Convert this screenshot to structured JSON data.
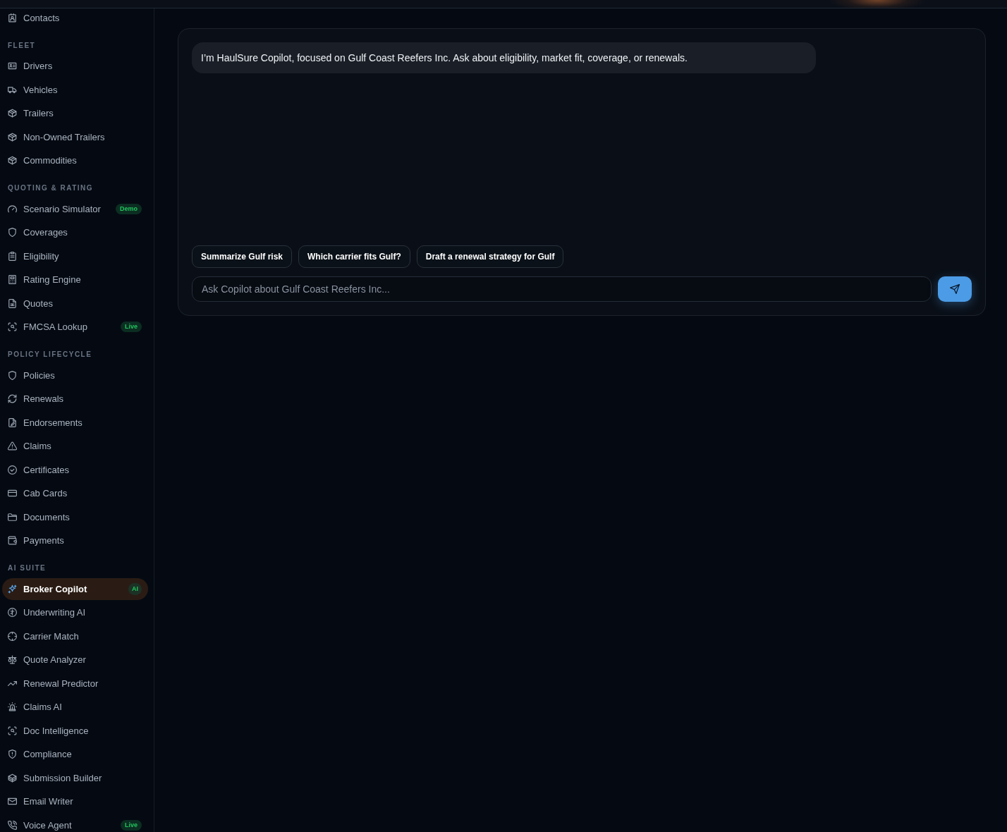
{
  "sidebar": {
    "items": [
      {
        "label": "Contacts",
        "selected": false
      }
    ],
    "sections": [
      {
        "title": "FLEET",
        "items": [
          {
            "label": "Drivers",
            "selected": false
          },
          {
            "label": "Vehicles",
            "selected": false
          },
          {
            "label": "Trailers",
            "selected": false
          },
          {
            "label": "Non-Owned Trailers",
            "selected": false
          },
          {
            "label": "Commodities",
            "selected": false
          }
        ]
      },
      {
        "title": "QUOTING & RATING",
        "items": [
          {
            "label": "Scenario Simulator",
            "selected": false,
            "badge": "Demo"
          },
          {
            "label": "Coverages",
            "selected": false
          },
          {
            "label": "Eligibility",
            "selected": false
          },
          {
            "label": "Rating Engine",
            "selected": false
          },
          {
            "label": "Quotes",
            "selected": false
          },
          {
            "label": "FMCSA Lookup",
            "selected": false,
            "badge": "Live"
          }
        ]
      },
      {
        "title": "POLICY LIFECYCLE",
        "items": [
          {
            "label": "Policies",
            "selected": false
          },
          {
            "label": "Renewals",
            "selected": false
          },
          {
            "label": "Endorsements",
            "selected": false
          },
          {
            "label": "Claims",
            "selected": false
          },
          {
            "label": "Certificates",
            "selected": false
          },
          {
            "label": "Cab Cards",
            "selected": false
          },
          {
            "label": "Documents",
            "selected": false
          },
          {
            "label": "Payments",
            "selected": false
          }
        ]
      },
      {
        "title": "AI SUITE",
        "items": [
          {
            "label": "Broker Copilot",
            "selected": true,
            "badge": "AI"
          },
          {
            "label": "Underwriting AI",
            "selected": false
          },
          {
            "label": "Carrier Match",
            "selected": false
          },
          {
            "label": "Quote Analyzer",
            "selected": false
          },
          {
            "label": "Renewal Predictor",
            "selected": false
          },
          {
            "label": "Claims AI",
            "selected": false
          },
          {
            "label": "Doc Intelligence",
            "selected": false
          },
          {
            "label": "Compliance",
            "selected": false
          },
          {
            "label": "Submission Builder",
            "selected": false
          },
          {
            "label": "Email Writer",
            "selected": false
          },
          {
            "label": "Voice Agent",
            "selected": false,
            "badge": "Live"
          }
        ]
      }
    ]
  },
  "chat": {
    "messages": [
      {
        "text": "I’m HaulSure Copilot, focused on Gulf Coast Reefers Inc. Ask about eligibility, market fit, coverage, or renewals."
      }
    ],
    "suggestions": [
      "Summarize Gulf risk",
      "Which carrier fits Gulf?",
      "Draft a renewal strategy for Gulf"
    ],
    "input": {
      "placeholder": "Ask Copilot about Gulf Coast Reefers Inc..."
    }
  }
}
